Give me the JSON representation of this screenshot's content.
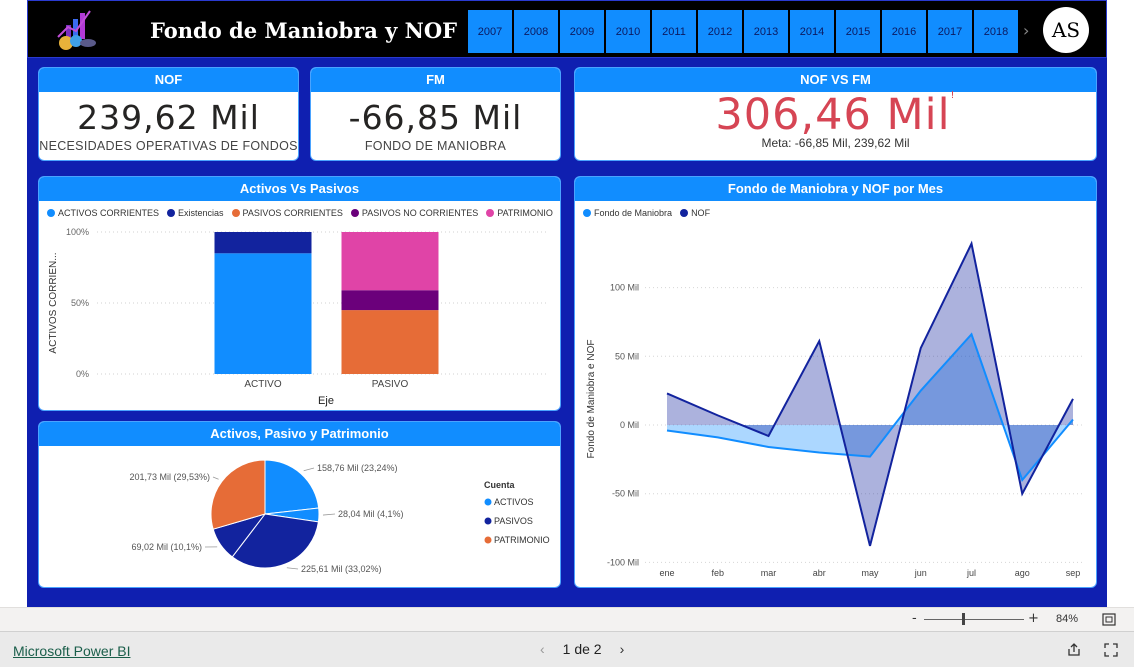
{
  "header": {
    "title": "Fondo de Maniobra y NOF",
    "years": [
      "2007",
      "2008",
      "2009",
      "2010",
      "2011",
      "2012",
      "2013",
      "2014",
      "2015",
      "2016",
      "2017",
      "2018"
    ],
    "avatar_text": "AS"
  },
  "kpis": {
    "nof": {
      "title": "NOF",
      "value": "239,62 Mil",
      "subtitle": "NECESIDADES OPERATIVAS DE FONDOS"
    },
    "fm": {
      "title": "FM",
      "value": "-66,85 Mil",
      "subtitle": "FONDO DE MANIOBRA"
    },
    "nof_vs_fm": {
      "title": "NOF VS FM",
      "value": "306,46 Mil",
      "warning": "!",
      "goal": "Meta: -66,85 Mil, 239,62 Mil"
    }
  },
  "colors": {
    "accent": "#118dff",
    "navy": "#12239e",
    "orange": "#e66c37",
    "purple": "#6b007b",
    "pink": "#e044a7",
    "red": "#d64554",
    "background": "#0f1fb0"
  },
  "chart_data": [
    {
      "type": "bar",
      "stacked": "100%",
      "title": "Activos Vs Pasivos",
      "xlabel": "Eje",
      "ylabel": "ACTIVOS CORRIEN...",
      "categories": [
        "ACTIVO",
        "PASIVO"
      ],
      "yticks": [
        "0%",
        "50%",
        "100%"
      ],
      "series": [
        {
          "name": "ACTIVOS CORRIENTES",
          "color": "#118dff",
          "values": [
            85,
            0
          ]
        },
        {
          "name": "Existencias",
          "color": "#12239e",
          "values": [
            15,
            0
          ]
        },
        {
          "name": "PASIVOS CORRIENTES",
          "color": "#e66c37",
          "values": [
            0,
            45
          ]
        },
        {
          "name": "PASIVOS NO CORRIENTES",
          "color": "#6b007b",
          "values": [
            0,
            14
          ]
        },
        {
          "name": "PATRIMONIO",
          "color": "#e044a7",
          "values": [
            0,
            41
          ]
        }
      ]
    },
    {
      "type": "pie",
      "title": "Activos, Pasivo y Patrimonio",
      "legend_title": "Cuenta",
      "legend": [
        {
          "name": "ACTIVOS",
          "color": "#118dff"
        },
        {
          "name": "PASIVOS",
          "color": "#12239e"
        },
        {
          "name": "PATRIMONIO",
          "color": "#e66c37"
        }
      ],
      "slices": [
        {
          "label": "158,76 Mil (23,24%)",
          "value": 23.24,
          "color": "#118dff"
        },
        {
          "label": "28,04 Mil (4,1%)",
          "value": 4.1,
          "color": "#118dff"
        },
        {
          "label": "225,61 Mil (33,02%)",
          "value": 33.02,
          "color": "#12239e"
        },
        {
          "label": "69,02 Mil (10,1%)",
          "value": 10.1,
          "color": "#12239e"
        },
        {
          "label": "201,73 Mil (29,53%)",
          "value": 29.53,
          "color": "#e66c37"
        }
      ]
    },
    {
      "type": "area",
      "title": "Fondo de Maniobra y NOF por Mes",
      "ylabel": "Fondo de Maniobra e NOF",
      "x": [
        "ene",
        "feb",
        "mar",
        "abr",
        "may",
        "jun",
        "jul",
        "ago",
        "sep"
      ],
      "yticks": [
        "-100 Mil",
        "-50 Mil",
        "0 Mil",
        "50 Mil",
        "100 Mil"
      ],
      "yrange": [
        -100,
        130
      ],
      "series": [
        {
          "name": "Fondo de Maniobra",
          "color": "#118dff",
          "values": [
            -4,
            -9,
            -16,
            -20,
            -23,
            25,
            66,
            -40,
            4
          ]
        },
        {
          "name": "NOF",
          "color": "#12239e",
          "values": [
            23,
            7,
            -8,
            61,
            -88,
            56,
            132,
            -50,
            19
          ]
        }
      ]
    }
  ],
  "zoom": {
    "minus": "-",
    "plus": "+",
    "level": "84%"
  },
  "footer": {
    "brand": "Microsoft Power BI",
    "page": "1 de 2"
  }
}
